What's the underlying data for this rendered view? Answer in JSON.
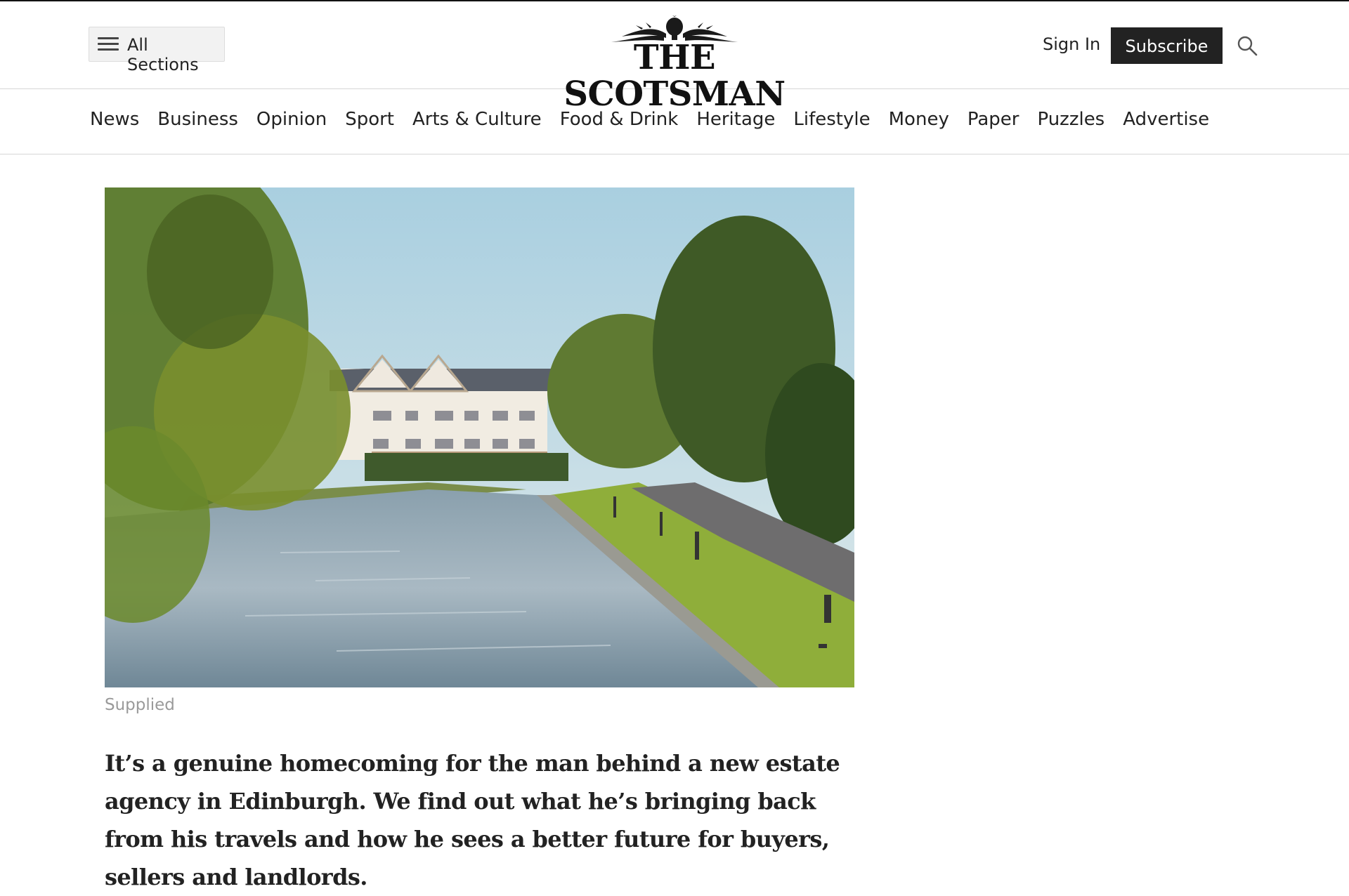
{
  "header": {
    "all_sections_label": "All Sections",
    "logo_text": "THE SCOTSMAN",
    "sign_in_label": "Sign In",
    "subscribe_label": "Subscribe"
  },
  "nav": {
    "items": [
      "News",
      "Business",
      "Opinion",
      "Sport",
      "Arts & Culture",
      "Food & Drink",
      "Heritage",
      "Lifestyle",
      "Money",
      "Paper",
      "Puzzles",
      "Advertise"
    ]
  },
  "article": {
    "image_caption": "Supplied",
    "standfirst": "It’s a genuine homecoming for the man behind a new estate agency in Edinburgh. We find out what he’s bringing back from his travels and how he sees a better future for buyers, sellers and landlords."
  },
  "colors": {
    "subscribe_bg": "#222222",
    "text": "#222222",
    "caption": "#9a9a9a"
  }
}
